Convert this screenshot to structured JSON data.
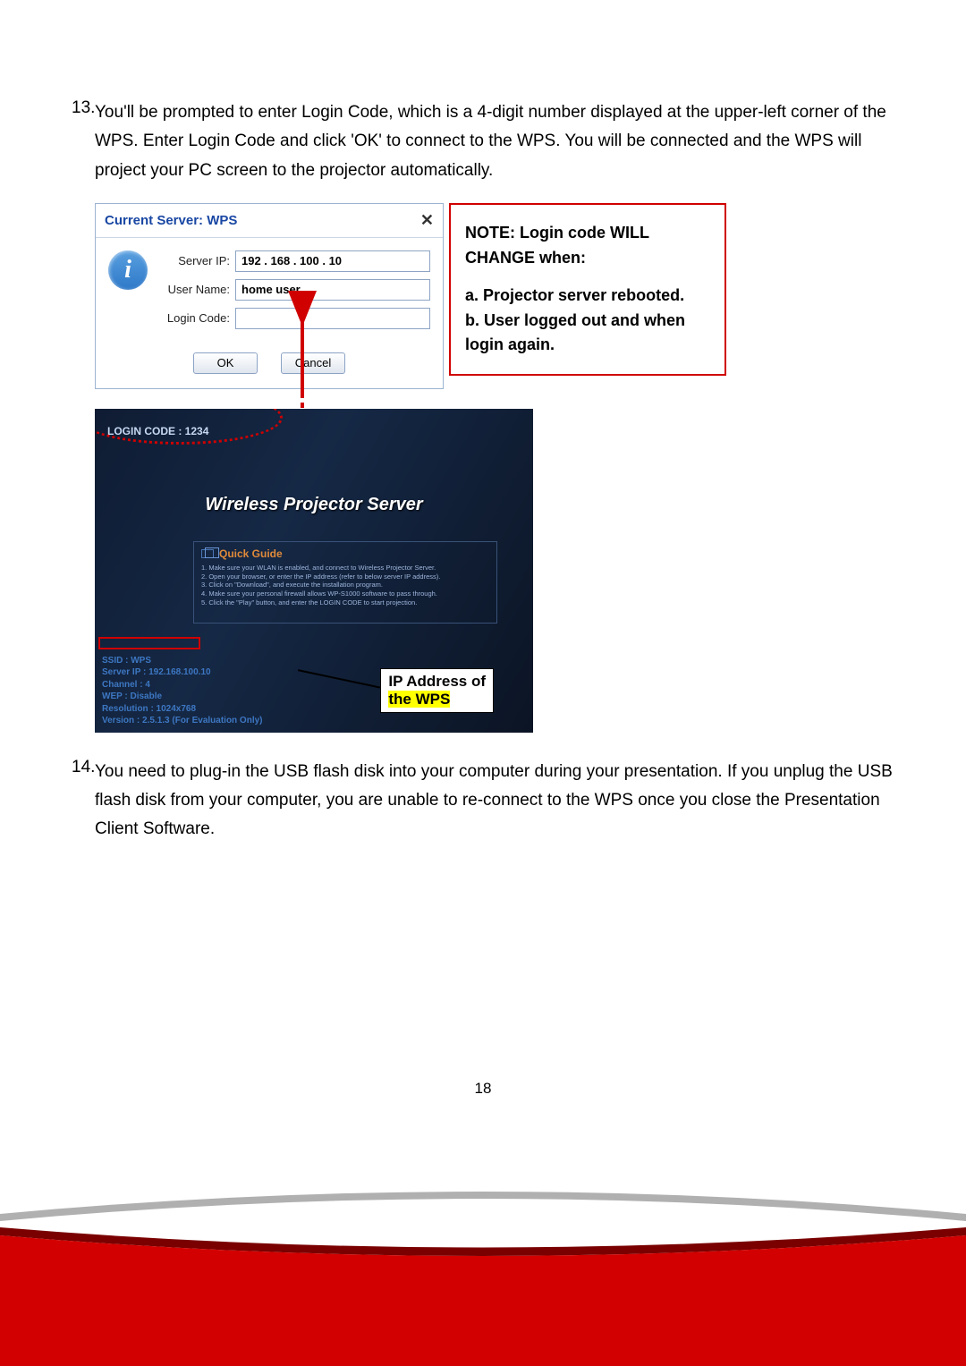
{
  "steps": {
    "s13_num": "13.",
    "s13_text": "You'll be prompted to enter Login Code, which is a 4-digit number displayed at the upper-left corner of the WPS. Enter Login Code and click 'OK' to connect to the WPS. You will be connected and the WPS will project your PC screen to the projector automatically.",
    "s14_num": "14.",
    "s14_text": "You need to plug-in the USB flash disk into your computer during your presentation. If you unplug the USB flash disk from your computer, you are unable to re-connect to the WPS once you close the Presentation Client Software."
  },
  "dialog": {
    "title": "Current Server: WPS",
    "close": "✕",
    "server_ip_label": "Server IP:",
    "server_ip_value": "192 . 168 . 100 . 10",
    "user_name_label": "User Name:",
    "user_name_value": "home user",
    "login_code_label": "Login Code:",
    "login_code_value": "",
    "ok": "OK",
    "cancel": "Cancel",
    "info_glyph": "i"
  },
  "note": {
    "line1": "NOTE: Login code WILL CHANGE when:",
    "a": "a. Projector server rebooted.",
    "b": "b. User logged out and when login again."
  },
  "projector": {
    "login_code_badge": "LOGIN CODE : 1234",
    "title": "Wireless Projector Server",
    "quick_guide_title": "Quick Guide",
    "qg_items": [
      "Make sure your WLAN is enabled, and connect to Wireless Projector Server.",
      "Open your browser, or enter the IP address (refer to below server IP address).",
      "Click on \"Download\", and execute the installation program.",
      "Make sure your personal firewall allows WP-S1000 software to pass through.",
      "Click the \"Play\" button, and enter the LOGIN CODE to start projection."
    ],
    "info_lines": [
      "SSID : WPS",
      "Server IP : 192.168.100.10",
      "Channel : 4",
      "WEP : Disable",
      "Resolution : 1024x768",
      "Version : 2.5.1.3 (For Evaluation Only)"
    ],
    "callout_l1": "IP Address of",
    "callout_l2": "the WPS"
  },
  "page_number": "18"
}
